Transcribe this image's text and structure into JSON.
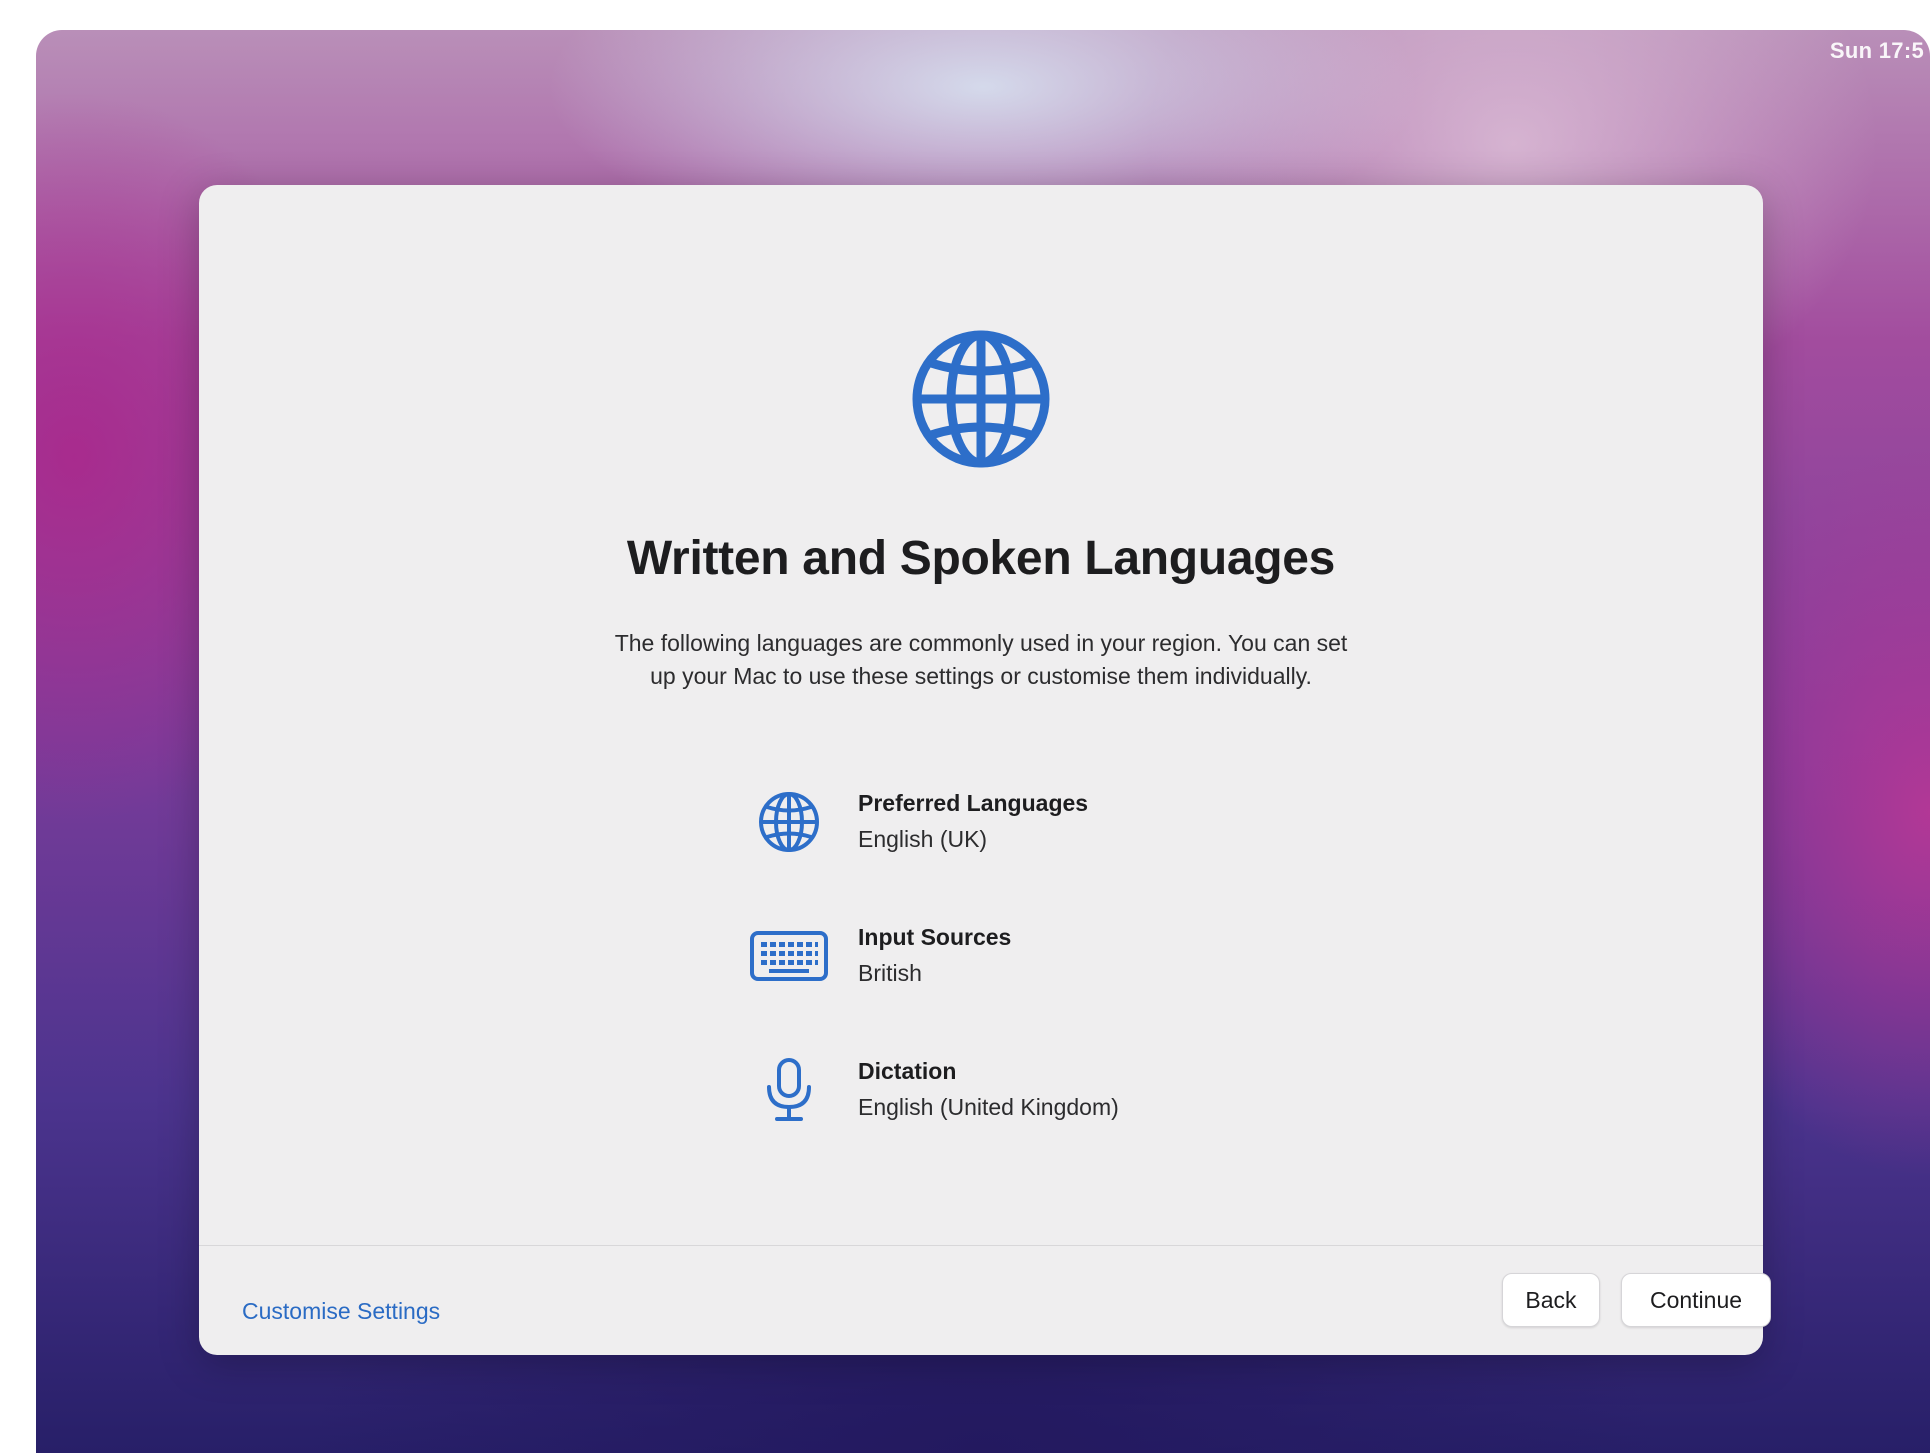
{
  "menubar": {
    "clock": "Sun 17:5"
  },
  "dialog": {
    "hero_icon": "globe-icon",
    "title": "Written and Spoken Languages",
    "subtitle_line1": "The following languages are commonly used in your region. You can set",
    "subtitle_line2": "up your Mac to use these settings or customise them individually.",
    "settings": [
      {
        "icon": "globe-icon",
        "label": "Preferred Languages",
        "value": "English (UK)"
      },
      {
        "icon": "keyboard-icon",
        "label": "Input Sources",
        "value": "British"
      },
      {
        "icon": "microphone-icon",
        "label": "Dictation",
        "value": "English (United Kingdom)"
      }
    ]
  },
  "footer": {
    "customise_label": "Customise Settings",
    "back_label": "Back",
    "continue_label": "Continue"
  },
  "colors": {
    "accent": "#2a6bc4",
    "icon_blue": "#2d6ec9",
    "dialog_bg": "#efeeef"
  }
}
